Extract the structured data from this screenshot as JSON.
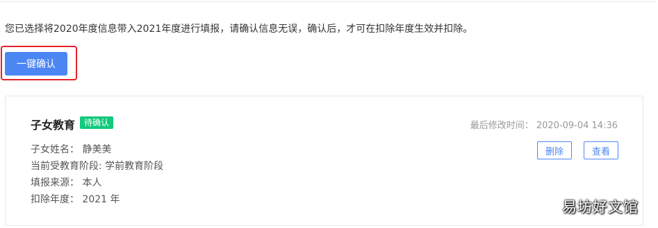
{
  "notice": "您已选择将2020年度信息带入2021年度进行填报，请确认信息无误，确认后，才可在扣除年度生效并扣除。",
  "confirm_button_label": "一键确认",
  "card": {
    "title": "子女教育",
    "status": "待确认",
    "modified_label": "最后修改时间：",
    "modified_time": "2020-09-04 14:36",
    "fields": [
      {
        "label": "子女姓名：",
        "value": "静美美"
      },
      {
        "label": "当前受教育阶段:",
        "value": "学前教育阶段"
      },
      {
        "label": "填报来源：",
        "value": "本人"
      },
      {
        "label": "扣除年度：",
        "value": "2021 年"
      }
    ],
    "delete_label": "删除",
    "view_label": "查看"
  },
  "watermark": "易坊好文馆",
  "colors": {
    "primary": "#4c86f3",
    "status_green": "#12c97d",
    "highlight_red": "#e8202a"
  }
}
